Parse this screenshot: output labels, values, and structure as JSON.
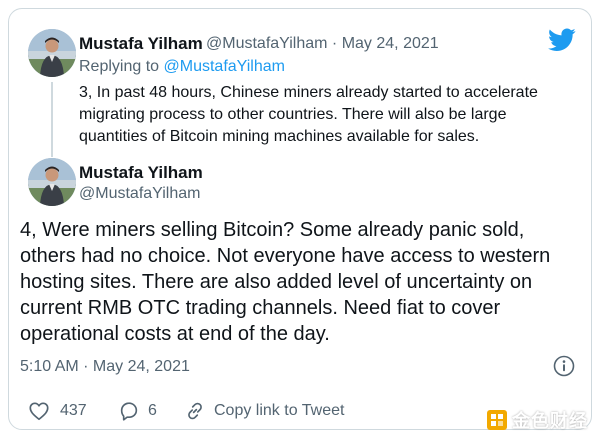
{
  "reply_tweet": {
    "author_name": "Mustafa Yilham",
    "author_handle": "@MustafaYilham",
    "separator": "·",
    "date": "May 24, 2021",
    "replying_prefix": "Replying to",
    "replying_to": "@MustafaYilham",
    "text": "3, In past 48 hours, Chinese miners already started to accelerate migrating process to other countries. There will also be large quantities of Bitcoin mining machines available for sales."
  },
  "main_tweet": {
    "author_name": "Mustafa Yilham",
    "author_handle": "@MustafaYilham",
    "text": "4, Were miners selling Bitcoin? Some already panic sold, others had no choice. Not everyone have access to western hosting sites. There are also added level of uncertainty on current RMB OTC trading channels. Need fiat to cover operational costs at end of the day.",
    "timestamp": "5:10 AM · May 24, 2021"
  },
  "actions": {
    "likes": "437",
    "replies": "6",
    "copy_link_label": "Copy link to Tweet"
  },
  "icons": {
    "brand": "twitter-bird-icon",
    "info": "info-icon",
    "like": "heart-icon",
    "reply": "reply-icon",
    "copy": "link-icon"
  },
  "watermark": {
    "text": "金色财经"
  },
  "colors": {
    "twitter_blue": "#1d9bf0",
    "secondary_text": "#536471",
    "primary_text": "#0f1419",
    "border": "#cfd9de",
    "watermark_gold": "#f2a900"
  }
}
